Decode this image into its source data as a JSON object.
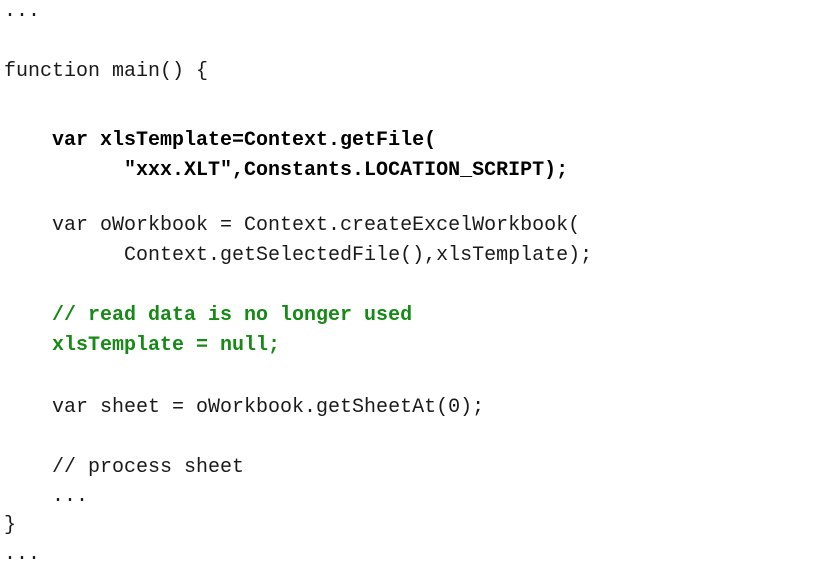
{
  "code": {
    "lines": [
      {
        "text": "...",
        "style": "plain"
      },
      {
        "text": "function main() {",
        "style": "plain"
      },
      {
        "text": "    var xlsTemplate=Context.getFile(",
        "style": "bold"
      },
      {
        "text": "          \"xxx.XLT\",Constants.LOCATION_SCRIPT);",
        "style": "bold"
      },
      {
        "text": "    var oWorkbook = Context.createExcelWorkbook(",
        "style": "plain"
      },
      {
        "text": "          Context.getSelectedFile(),xlsTemplate);",
        "style": "plain"
      },
      {
        "text": "    // read data is no longer used",
        "style": "bold-green"
      },
      {
        "text": "    xlsTemplate = null;",
        "style": "bold-green"
      },
      {
        "text": "    var sheet = oWorkbook.getSheetAt(0);",
        "style": "plain"
      },
      {
        "text": "    // process sheet",
        "style": "plain"
      },
      {
        "text": "    ...",
        "style": "plain"
      },
      {
        "text": "}",
        "style": "plain"
      },
      {
        "text": "...",
        "style": "plain"
      }
    ]
  }
}
